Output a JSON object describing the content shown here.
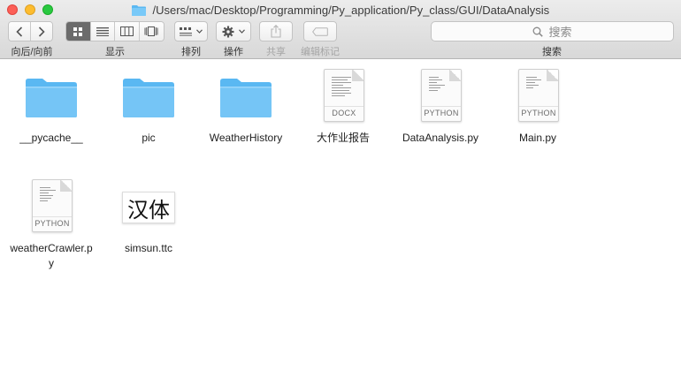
{
  "window": {
    "title": "/Users/mac/Desktop/Programming/Py_application/Py_class/GUI/DataAnalysis",
    "colors": {
      "folder": "#5ab8f2",
      "close": "#fc5f57",
      "minimize": "#fdbc2e",
      "maximize": "#29c840"
    }
  },
  "toolbar": {
    "nav_label": "向后/向前",
    "view_label": "显示",
    "arrange_label": "排列",
    "action_label": "操作",
    "share_label": "共享",
    "tags_label": "编辑标记",
    "search_placeholder": "搜索",
    "search_label": "搜索"
  },
  "files": [
    {
      "name": "__pycache__",
      "kind": "folder"
    },
    {
      "name": "pic",
      "kind": "folder"
    },
    {
      "name": "WeatherHistory",
      "kind": "folder"
    },
    {
      "name": "大作业报告",
      "kind": "document",
      "tag": "DOCX"
    },
    {
      "name": "DataAnalysis.py",
      "kind": "document",
      "tag": "PYTHON"
    },
    {
      "name": "Main.py",
      "kind": "document",
      "tag": "PYTHON"
    },
    {
      "name": "weatherCrawler.py",
      "name_line1": "weatherCrawler.p",
      "name_line2": "y",
      "kind": "document",
      "tag": "PYTHON"
    },
    {
      "name": "simsun.ttc",
      "kind": "font",
      "preview": "汉体"
    }
  ]
}
